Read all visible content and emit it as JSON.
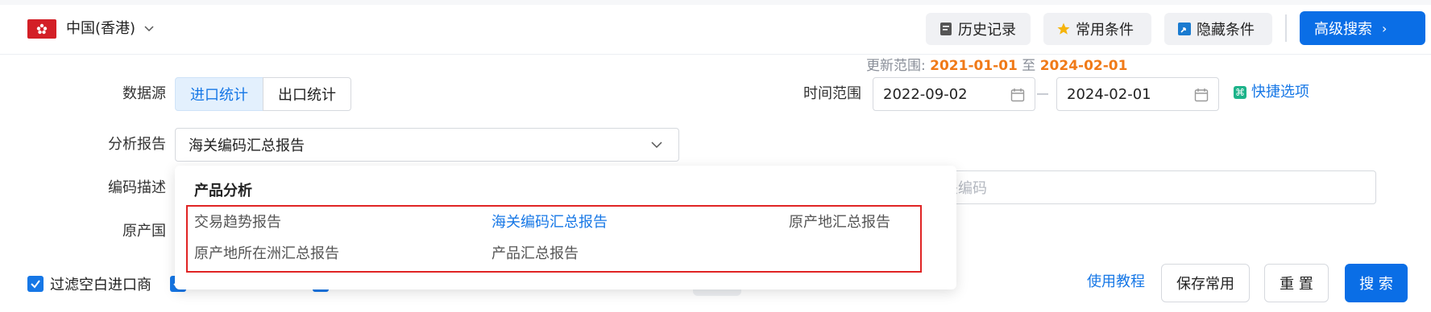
{
  "topbar": {
    "region": "中国(香港)",
    "history_label": "历史记录",
    "favorites_label": "常用条件",
    "hide_label": "隐藏条件",
    "advanced_label": "高级搜索"
  },
  "form": {
    "datasource_label": "数据源",
    "datasource_options": [
      "进口统计",
      "出口统计"
    ],
    "datasource_selected": "进口统计",
    "update_range_label": "更新范围:",
    "update_range_start": "2021-01-01",
    "update_range_to": "至",
    "update_range_end": "2024-02-01",
    "time_range_label": "时间范围",
    "date_start": "2022-09-02",
    "date_end": "2024-02-01",
    "quick_options_label": "快捷选项",
    "report_label": "分析报告",
    "report_value": "海关编码汇总报告",
    "code_desc_label": "编码描述",
    "code_placeholder_fragment": "关编码",
    "origin_label": "原产国"
  },
  "dropdown": {
    "group_title": "产品分析",
    "options": [
      "交易趋势报告",
      "海关编码汇总报告",
      "原产地汇总报告",
      "原产地所在洲汇总报告",
      "产品汇总报告"
    ],
    "selected": "海关编码汇总报告"
  },
  "bottom": {
    "filter_label": "过滤空白进口商",
    "tutorial_label": "使用教程",
    "save_label": "保存常用",
    "reset_label": "重 置",
    "search_label": "搜 索"
  },
  "colors": {
    "primary": "#0a6ee6",
    "highlight_orange": "#f07a18",
    "annotation_red": "#e02424"
  }
}
